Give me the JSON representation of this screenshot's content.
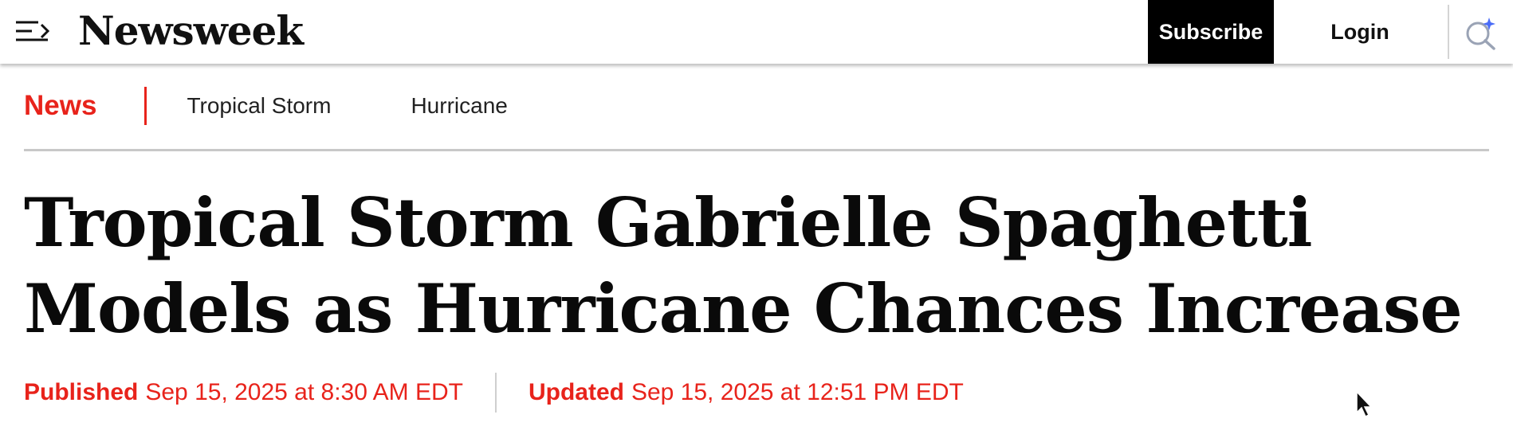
{
  "header": {
    "logo_text": "Newsweek",
    "subscribe_label": "Subscribe",
    "login_label": "Login",
    "icons": {
      "menu": "menu-arrow-icon",
      "search": "search-sparkle-icon"
    }
  },
  "topics": {
    "primary": "News",
    "links": [
      "Tropical Storm",
      "Hurricane"
    ]
  },
  "article": {
    "headline": "Tropical Storm Gabrielle Spaghetti Models as Hurricane Chances Increase",
    "published_label": "Published",
    "published_date": "Sep 15, 2025 at 8:30 AM EDT",
    "updated_label": "Updated",
    "updated_date": "Sep 15, 2025 at 12:51 PM EDT"
  },
  "colors": {
    "accent_red": "#e8231b",
    "subscribe_bg": "#000000",
    "search_icon": "#4a6cf7"
  }
}
